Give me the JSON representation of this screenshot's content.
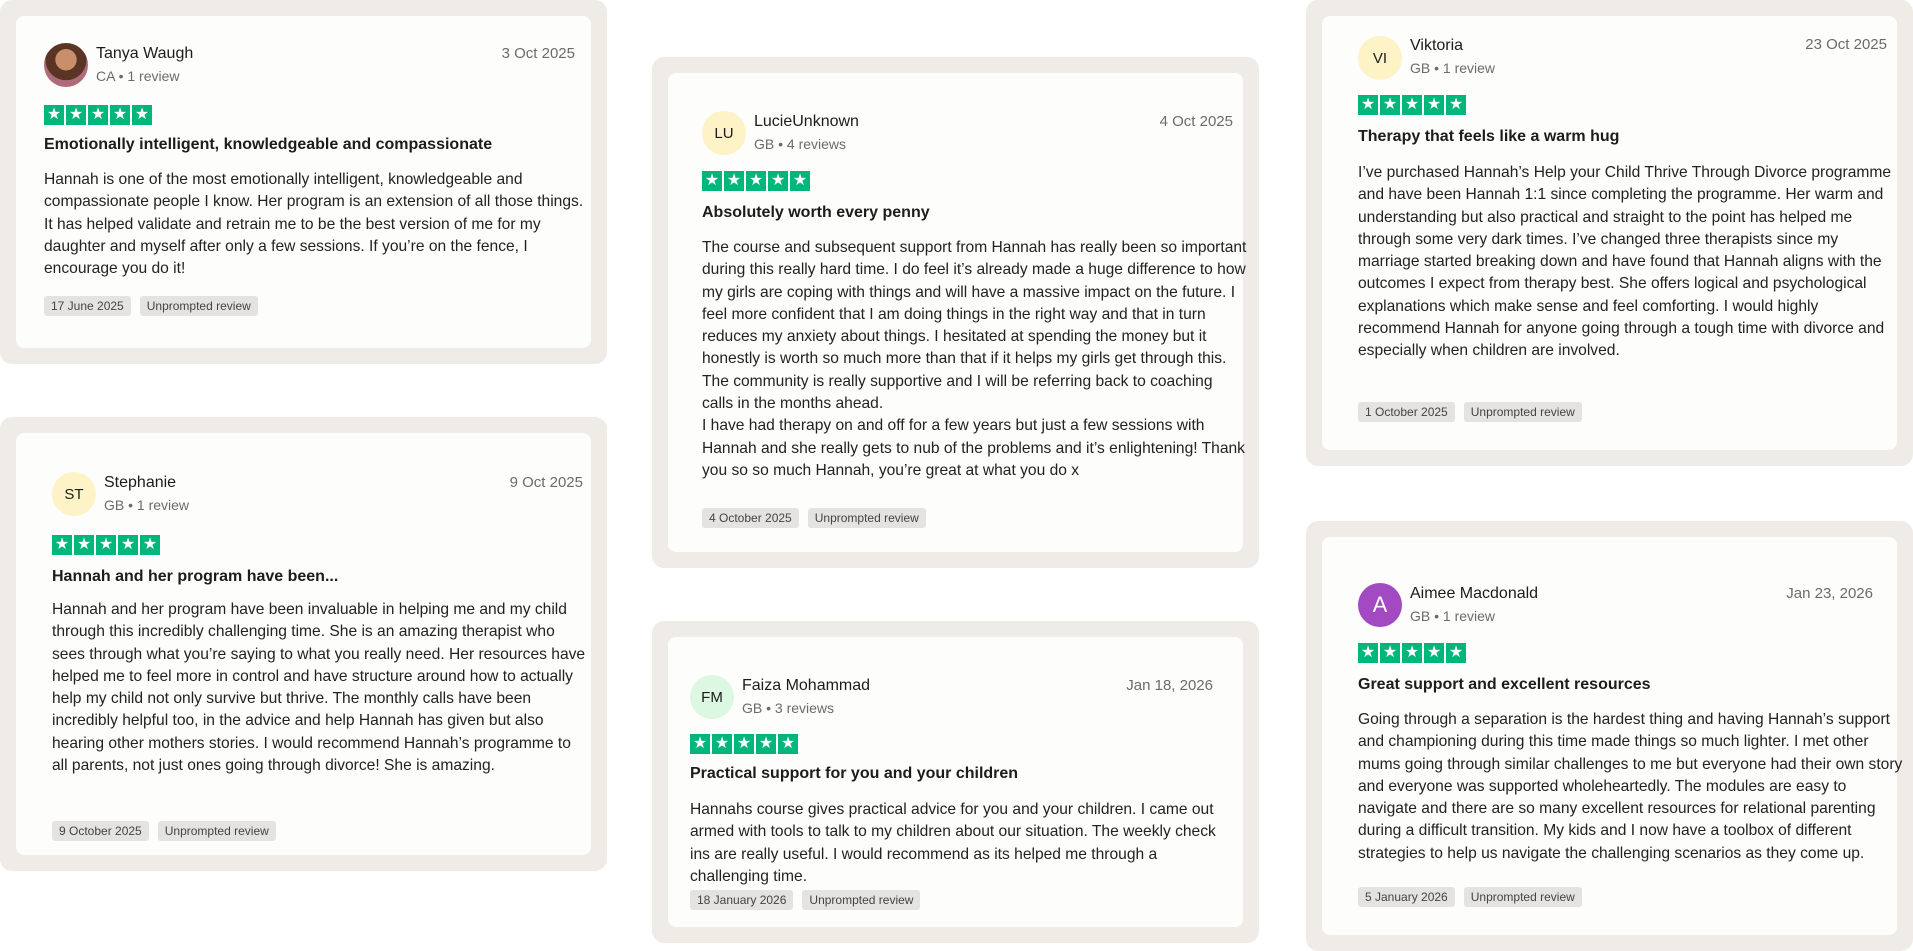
{
  "reviews": [
    {
      "name": "Tanya Waugh",
      "meta": "CA • 1 review",
      "date": "3 Oct 2025",
      "initials": "",
      "avatar_color": "photo",
      "rating": 5,
      "title": "Emotionally intelligent, knowledgeable and compassionate",
      "body": "Hannah is one of the most emotionally intelligent, knowledgeable and compassionate people I know. Her program is an extension of all those things. It has helped validate and retrain me to be the best version of me for my daughter and myself after only a few sessions. If you’re on the fence, I encourage you do it!",
      "experience_date": "17 June 2025",
      "tag": "Unprompted review"
    },
    {
      "name": "Stephanie",
      "meta": "GB • 1 review",
      "date": "9 Oct 2025",
      "initials": "ST",
      "avatar_color": "#fdf3c6",
      "rating": 5,
      "title": "Hannah and her program have been...",
      "body": "Hannah and her program have been invaluable in helping me and my child through this incredibly challenging time. She is an amazing therapist who sees through what you’re saying to what you really need. Her resources have helped me to feel more in control and have structure around how to actually help my child not only survive but thrive. The monthly calls have been incredibly helpful too, in the advice and help Hannah has given but also hearing other mothers stories. I would recommend Hannah’s programme to all parents, not just ones going through divorce! She is amazing.",
      "experience_date": "9 October 2025",
      "tag": "Unprompted review"
    },
    {
      "name": "LucieUnknown",
      "meta": "GB • 4 reviews",
      "date": "4 Oct 2025",
      "initials": "LU",
      "avatar_color": "#fdf3c6",
      "rating": 5,
      "title": "Absolutely worth every penny",
      "body": "The course and subsequent support from Hannah has really been so important during this really hard time. I do feel it’s already made a huge difference to how my girls are coping with things and will have a massive impact on the future. I feel more confident that I am doing things in the right way and that in turn reduces my anxiety about things. I hesitated at spending the money but it honestly is worth so much more than that if it helps my girls get through this.\nThe community is really supportive and I will be referring back to coaching calls in the months ahead.\nI have had therapy on and off for a few years but just a few sessions with Hannah and she really gets to nub of the problems and it’s enlightening! Thank you so so much Hannah, you’re great at what you do x",
      "experience_date": "4 October 2025",
      "tag": "Unprompted review"
    },
    {
      "name": "Faiza Mohammad",
      "meta": "GB • 3 reviews",
      "date": "Jan 18, 2026",
      "initials": "FM",
      "avatar_color": "#dcf7e2",
      "rating": 5,
      "title": "Practical support for you and your children",
      "body": "Hannahs course gives practical advice for you and your children. I came out armed with tools to talk to my children about our situation. The weekly check ins are really useful. I would recommend as its helped me through a challenging time.",
      "experience_date": "18 January 2026",
      "tag": "Unprompted review"
    },
    {
      "name": "Viktoria",
      "meta": "GB • 1 review",
      "date": "23 Oct 2025",
      "initials": "VI",
      "avatar_color": "#fdf3c6",
      "rating": 5,
      "title": "Therapy that feels like a warm hug",
      "body": "I’ve purchased Hannah’s Help your Child Thrive Through Divorce programme and have been Hannah 1:1 since completing the programme. Her warm and understanding but also practical and straight to the point has helped me through some very dark times. I’ve changed three therapists since my marriage started breaking down and have found that Hannah aligns with the outcomes I expect from therapy best. She offers logical and psychological explanations which make sense and feel comforting. I would highly recommend Hannah for anyone going through a tough time with divorce and especially when children are involved.",
      "experience_date": "1 October 2025",
      "tag": "Unprompted review"
    },
    {
      "name": "Aimee Macdonald",
      "meta": "GB • 1 review",
      "date": "Jan 23, 2026",
      "initials": "A",
      "avatar_color": "#a349c2",
      "rating": 5,
      "title": "Great support and excellent resources",
      "body": "Going through a separation is the hardest thing and having Hannah’s support and championing during this time made things so much lighter. I met other mums going through similar challenges to me but everyone had their own story and everyone was supported wholeheartedly. The modules are easy to navigate and there are so many excellent resources for relational parenting during a difficult transition. My kids and I now have a toolbox of different strategies to help us navigate the challenging scenarios as they come up.",
      "experience_date": "5 January 2026",
      "tag": "Unprompted review"
    }
  ]
}
